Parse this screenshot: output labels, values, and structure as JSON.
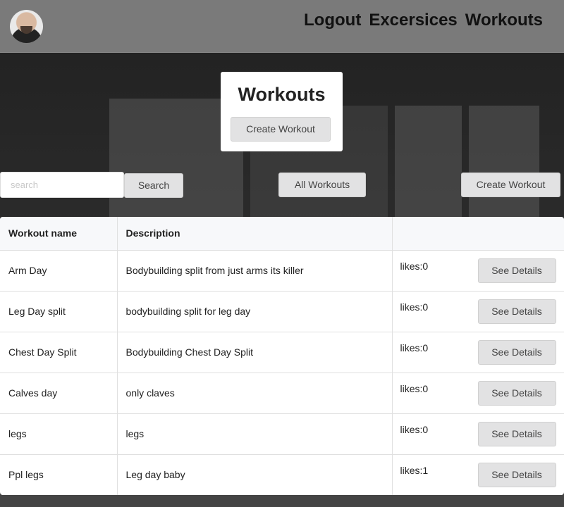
{
  "navbar": {
    "links": [
      "Logout",
      "Excersices",
      "Workouts"
    ]
  },
  "title_card": {
    "title": "Workouts",
    "create_label": "Create Workout"
  },
  "controls": {
    "search_placeholder": "search",
    "search_label": "Search",
    "all_label": "All Workouts",
    "create_label": "Create Workout"
  },
  "table": {
    "headers": [
      "Workout name",
      "Description",
      ""
    ],
    "rows": [
      {
        "name": "Arm Day",
        "description": "Bodybuilding split from just arms its killer",
        "likes": "likes:0",
        "action": "See Details"
      },
      {
        "name": "Leg Day split",
        "description": "bodybuilding split for leg day",
        "likes": "likes:0",
        "action": "See Details"
      },
      {
        "name": "Chest Day Split",
        "description": "Bodybuilding Chest Day Split",
        "likes": "likes:0",
        "action": "See Details"
      },
      {
        "name": "Calves day",
        "description": "only claves",
        "likes": "likes:0",
        "action": "See Details"
      },
      {
        "name": "legs",
        "description": "legs",
        "likes": "likes:0",
        "action": "See Details"
      },
      {
        "name": "Ppl legs",
        "description": "Leg day baby",
        "likes": "likes:1",
        "action": "See Details"
      }
    ]
  }
}
